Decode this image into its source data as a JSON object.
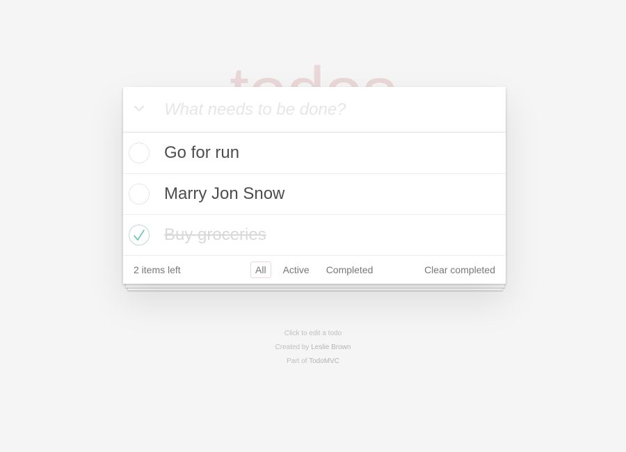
{
  "app": {
    "title": "todos"
  },
  "header": {
    "new_todo_placeholder": "What needs to be done?"
  },
  "todos": [
    {
      "label": "Go for run",
      "completed": false
    },
    {
      "label": "Marry Jon Snow",
      "completed": false
    },
    {
      "label": "Buy groceries",
      "completed": true
    }
  ],
  "footer": {
    "count_text": "2 items left",
    "filters": [
      {
        "label": "All",
        "selected": true
      },
      {
        "label": "Active",
        "selected": false
      },
      {
        "label": "Completed",
        "selected": false
      }
    ],
    "clear_completed_label": "Clear completed"
  },
  "info": {
    "hint": "Click to edit a todo",
    "created_by_prefix": "Created by",
    "created_by_name": "Leslie Brown",
    "part_of_prefix": "Part of",
    "part_of_name": "TodoMVC"
  },
  "colors": {
    "background": "#f5f5f5",
    "title": "rgba(175,47,47,0.15)",
    "checkmark": "#5dc2af",
    "completed_text": "#d9d9d9"
  }
}
